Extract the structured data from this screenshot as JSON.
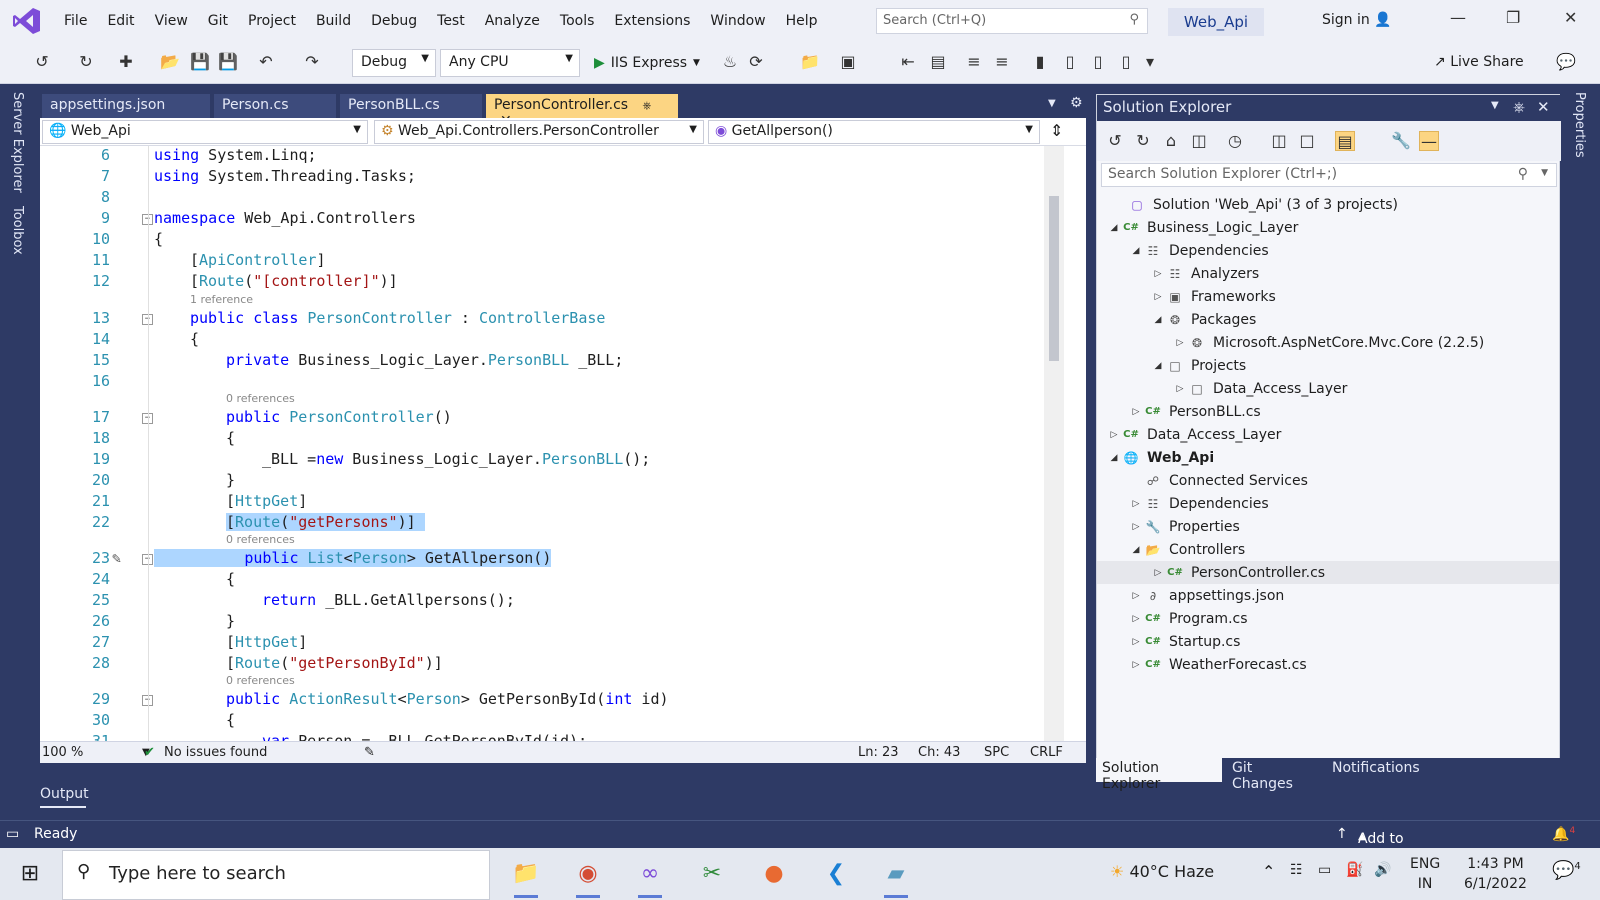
{
  "menu": [
    "File",
    "Edit",
    "View",
    "Git",
    "Project",
    "Build",
    "Debug",
    "Test",
    "Analyze",
    "Tools",
    "Extensions",
    "Window",
    "Help"
  ],
  "search": {
    "placeholder": "Search (Ctrl+Q)"
  },
  "solution_badge": "Web_Api",
  "sign_in": "Sign in",
  "toolbar": {
    "config": "Debug",
    "platform": "Any CPU",
    "run_target": "IIS Express",
    "live_share": "Live Share"
  },
  "left_rail": [
    "Server Explorer",
    "Toolbox"
  ],
  "right_rail": [
    "Properties"
  ],
  "tabs": [
    "appsettings.json",
    "Person.cs",
    "PersonBLL.cs",
    "PersonController.cs"
  ],
  "nav": {
    "project": "Web_Api",
    "class": "Web_Api.Controllers.PersonController",
    "member": "GetAllperson()"
  },
  "code": {
    "ln6": "6",
    "ln7": "7",
    "ln8": "8",
    "ln9": "9",
    "ln10": "10",
    "ln11": "11",
    "ln12": "12",
    "ln13": "13",
    "ln14": "14",
    "ln15": "15",
    "ln16": "16",
    "ln17": "17",
    "ln18": "18",
    "ln19": "19",
    "ln20": "20",
    "ln21": "21",
    "ln22": "22",
    "ln23": "23",
    "ln24": "24",
    "ln25": "25",
    "ln26": "26",
    "ln27": "27",
    "ln28": "28",
    "ln29": "29",
    "ln30": "30",
    "ln31": "31",
    "lens_1ref": "1 reference",
    "lens_0ref": "0 references"
  },
  "editor_status": {
    "zoom": "100 %",
    "issues": "No issues found",
    "ln": "Ln: 23",
    "ch": "Ch: 43",
    "spc": "SPC",
    "crlf": "CRLF"
  },
  "solution_explorer": {
    "title": "Solution Explorer",
    "search_placeholder": "Search Solution Explorer (Ctrl+;)",
    "tree": [
      "Solution 'Web_Api' (3 of 3 projects)",
      "Business_Logic_Layer",
      "Dependencies",
      "Analyzers",
      "Frameworks",
      "Packages",
      "Microsoft.AspNetCore.Mvc.Core (2.2.5)",
      "Projects",
      "Data_Access_Layer",
      "PersonBLL.cs",
      "Data_Access_Layer",
      "Web_Api",
      "Connected Services",
      "Dependencies",
      "Properties",
      "Controllers",
      "PersonController.cs",
      "appsettings.json",
      "Program.cs",
      "Startup.cs",
      "WeatherForecast.cs"
    ],
    "bottom_tabs": [
      "Solution Explorer",
      "Git Changes",
      "Notifications"
    ]
  },
  "output_label": "Output",
  "status": {
    "ready": "Ready",
    "source_control": "Add to Source Control",
    "notif_count": "4"
  },
  "taskbar": {
    "search_placeholder": "Type here to search",
    "weather_temp": "40°C",
    "weather_desc": "Haze",
    "lang1": "ENG",
    "lang2": "IN",
    "time": "1:43 PM",
    "date": "6/1/2022",
    "notif_count": "4"
  },
  "colors": {
    "accent": "#2e3a65",
    "active_tab": "#fcd583",
    "selection": "#add6ff",
    "vs_purple": "#7d4cd8"
  }
}
